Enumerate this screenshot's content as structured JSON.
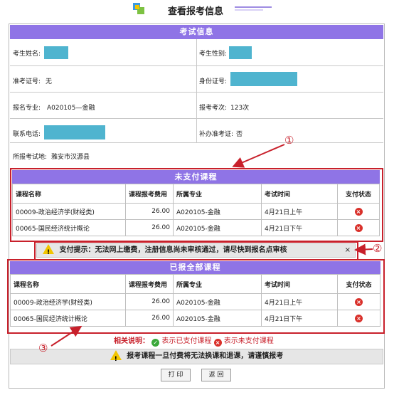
{
  "page": {
    "title": "查看报考信息"
  },
  "exam_info": {
    "header": "考试信息",
    "name_label": "考生姓名:",
    "gender_label": "考生性别:",
    "admission_label": "准考证号:",
    "admission_value": "无",
    "id_label": "身份证号:",
    "major_label": "报名专业:",
    "major_value": "A020105—金融",
    "count_label": "报考考次:",
    "count_value": "123次",
    "phone_label": "联系电话:",
    "reissue_label": "补办准考证:",
    "reissue_value": "否",
    "location_label": "所报考试地:",
    "location_value": "雅安市汉源县"
  },
  "unpaid": {
    "header": "未支付课程",
    "columns": [
      "课程名称",
      "课程报考费用",
      "所属专业",
      "考试时间",
      "支付状态"
    ],
    "rows": [
      {
        "course": "00009-政治经济学(财经类)",
        "fee": "26.00",
        "major": "A020105-金融",
        "time": "4月21日上午",
        "status": "unpaid"
      },
      {
        "course": "00065-国民经济统计概论",
        "fee": "26.00",
        "major": "A020105-金融",
        "time": "4月21日下午",
        "status": "unpaid"
      }
    ]
  },
  "pay_tip": {
    "text": "支付提示：无法网上缴费，注册信息尚未审核通过，请尽快到报名点审核",
    "close": "×"
  },
  "all_courses": {
    "header": "已报全部课程",
    "columns": [
      "课程名称",
      "课程报考费用",
      "所属专业",
      "考试时间",
      "支付状态"
    ],
    "rows": [
      {
        "course": "00009-政治经济学(财经类)",
        "fee": "26.00",
        "major": "A020105-金融",
        "time": "4月21日上午",
        "status": "unpaid"
      },
      {
        "course": "00065-国民经济统计概论",
        "fee": "26.00",
        "major": "A020105-金融",
        "time": "4月21日下午",
        "status": "unpaid"
      }
    ]
  },
  "legend": {
    "label": "相关说明：",
    "paid_text": "表示已支付课程",
    "unpaid_text": "表示未支付课程"
  },
  "notice": {
    "text": "报考课程一旦付费将无法换课和退课，请谨慎报考"
  },
  "buttons": {
    "print": "打 印",
    "back": "返 回"
  },
  "callouts": {
    "one": "①",
    "two": "②",
    "three": "③"
  },
  "colors": {
    "header_purple": "#8f74e6",
    "mask_cyan": "#4fb4cf",
    "annotation_red": "#c8202b"
  }
}
